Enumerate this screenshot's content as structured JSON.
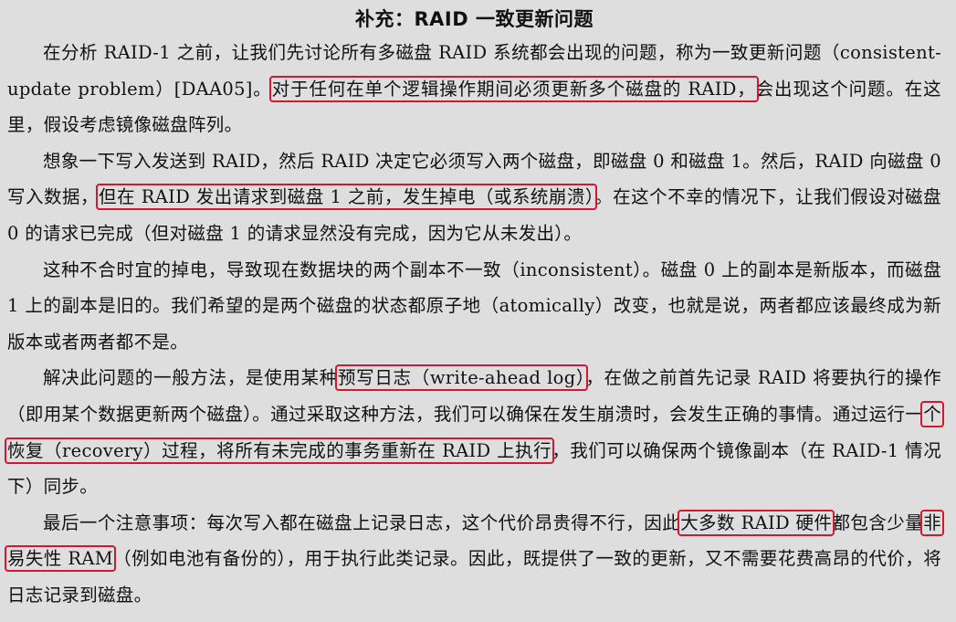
{
  "title": "补充：RAID 一致更新问题",
  "p1": {
    "a": "在分析 RAID-1 之前，让我们先讨论所有多磁盘 RAID 系统都会出现的问题，称为一致更新问题（consistent-update problem）[DAA05]。",
    "h1": "对于任何在单个逻辑操作期间必须更新多个磁盘的 RAID，",
    "b": "会出现这个问题。在这里，假设考虑镜像磁盘阵列。"
  },
  "p2": {
    "a": "想象一下写入发送到 RAID，然后 RAID 决定它必须写入两个磁盘，即磁盘 0 和磁盘 1。然后，RAID 向磁盘 0 写入数据，",
    "h1": "但在 RAID 发出请求到磁盘 1 之前，发生掉电（或系统崩溃）",
    "b": "。在这个不幸的情况下，让我们假设对磁盘 0 的请求已完成（但对磁盘 1 的请求显然没有完成，因为它从未发出）。"
  },
  "p3": {
    "a": "这种不合时宜的掉电，导致现在数据块的两个副本不一致（inconsistent）。磁盘 0 上的副本是新版本，而磁盘 1 上的副本是旧的。我们希望的是两个磁盘的状态都原子地（atomically）改变，也就是说，两者都应该最终成为新版本或者两者都不是。"
  },
  "p4": {
    "a": "解决此问题的一般方法，是使用某种",
    "h1": "预写日志（write-ahead log）",
    "b": "，在做之前首先记录 RAID 将要执行的操作（即用某个数据更新两个磁盘）。通过采取这种方法，我们可以确保在发生崩溃时，会发生正确的事情。通过运行一",
    "h2": "个恢复（recovery）过程，将所有未完成的事务重新在 RAID 上执行",
    "c": "，我们可以确保两个镜像副本（在 RAID-1 情况下）同步。"
  },
  "p5": {
    "a": "最后一个注意事项：每次写入都在磁盘上记录日志，这个代价昂贵得不行，因此",
    "h1": "大多数 RAID 硬件",
    "b": "都包含少量",
    "h2": "非易失性 RAM",
    "c": "（例如电池有备份的），用于执行此类记录。因此，既提供了一致的更新，又不需要花费高昂的代价，将日志记录到磁盘。"
  },
  "highlight_color": "#d0182e",
  "background_color": "#dedede"
}
